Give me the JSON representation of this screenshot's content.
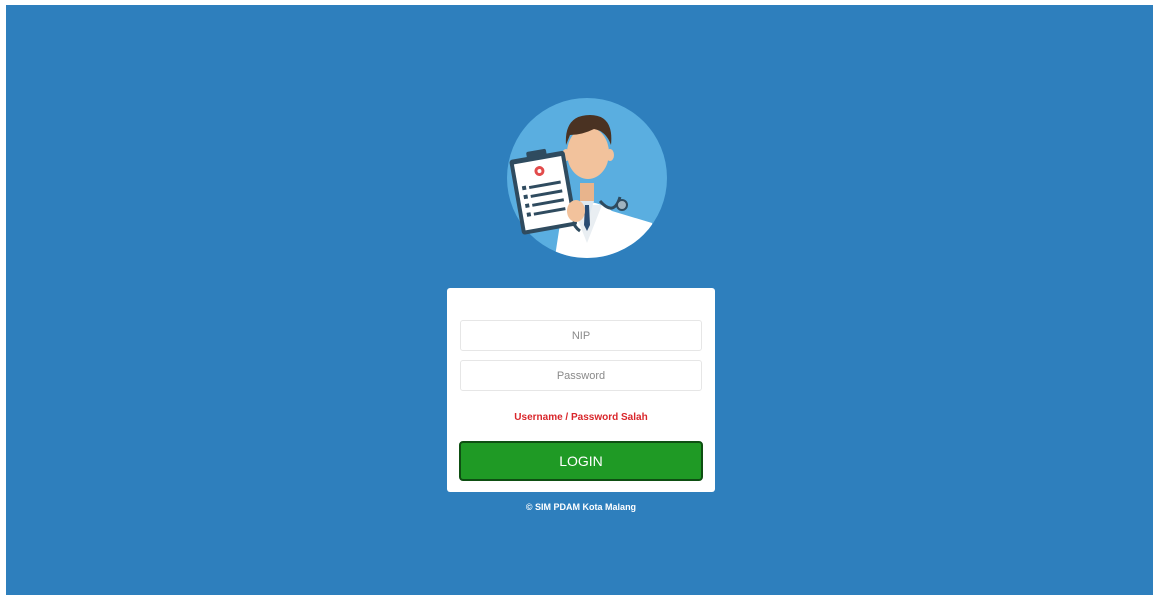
{
  "login": {
    "nip_placeholder": "NIP",
    "password_placeholder": "Password",
    "error_message": "Username / Password Salah",
    "button_label": "LOGIN"
  },
  "footer": {
    "copyright": "© SIM PDAM Kota Malang"
  },
  "colors": {
    "background": "#2e7fbd",
    "button": "#1f9a25",
    "error": "#d9262b"
  },
  "icons": {
    "avatar": "doctor-avatar-icon"
  }
}
